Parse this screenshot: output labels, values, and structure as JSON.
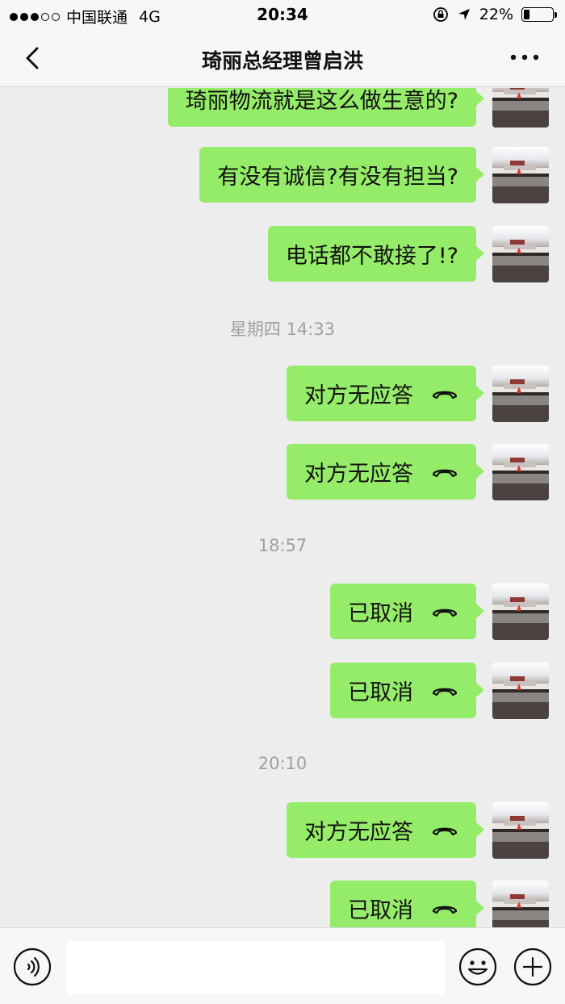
{
  "status_bar": {
    "carrier": "中国联通",
    "network": "4G",
    "time": "20:34",
    "battery_percent": "22%",
    "battery_level": 0.22,
    "signal_filled": 3,
    "signal_total": 5
  },
  "nav": {
    "title": "琦丽总经理曾启洪",
    "back_icon": "chevron-left-icon",
    "more_icon": "more-dots-icon"
  },
  "messages": [
    {
      "type": "text",
      "text": "琦丽物流就是这么做生意的?"
    },
    {
      "type": "text",
      "text": "有没有诚信?有没有担当?"
    },
    {
      "type": "text",
      "text": "电话都不敢接了!?"
    },
    {
      "type": "time",
      "text": "星期四 14:33"
    },
    {
      "type": "call",
      "text": "对方无应答"
    },
    {
      "type": "call",
      "text": "对方无应答"
    },
    {
      "type": "time",
      "text": "18:57"
    },
    {
      "type": "call",
      "text": "已取消"
    },
    {
      "type": "call",
      "text": "已取消"
    },
    {
      "type": "time",
      "text": "20:10"
    },
    {
      "type": "call",
      "text": "对方无应答"
    },
    {
      "type": "call",
      "text": "已取消"
    }
  ],
  "input_bar": {
    "voice_icon": "voice-icon",
    "emoji_icon": "emoji-icon",
    "plus_icon": "plus-icon",
    "input_value": ""
  },
  "colors": {
    "bubble": "#95ec69",
    "background": "#ededed",
    "bar": "#f7f7f7"
  }
}
